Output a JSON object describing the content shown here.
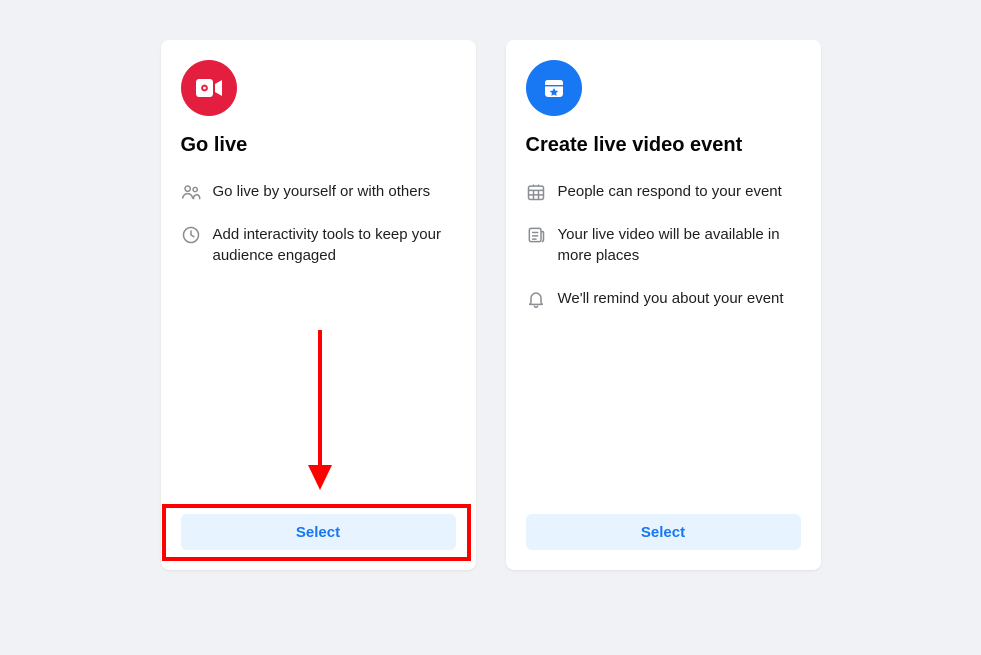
{
  "cards": [
    {
      "title": "Go live",
      "icon_name": "video-camera-icon",
      "icon_color": "red",
      "features": [
        {
          "icon": "people-icon",
          "text": "Go live by yourself or with others"
        },
        {
          "icon": "clock-icon",
          "text": "Add interactivity tools to keep your audience engaged"
        }
      ],
      "button_label": "Select",
      "highlighted": true
    },
    {
      "title": "Create live video event",
      "icon_name": "calendar-star-icon",
      "icon_color": "blue",
      "features": [
        {
          "icon": "calendar-icon",
          "text": "People can respond to your event"
        },
        {
          "icon": "news-icon",
          "text": "Your live video will be available in more places"
        },
        {
          "icon": "bell-icon",
          "text": "We'll remind you about your event"
        }
      ],
      "button_label": "Select",
      "highlighted": false
    }
  ],
  "annotation": {
    "arrow_target": "go-live-select-button",
    "highlight_target": "go-live-select-button"
  }
}
